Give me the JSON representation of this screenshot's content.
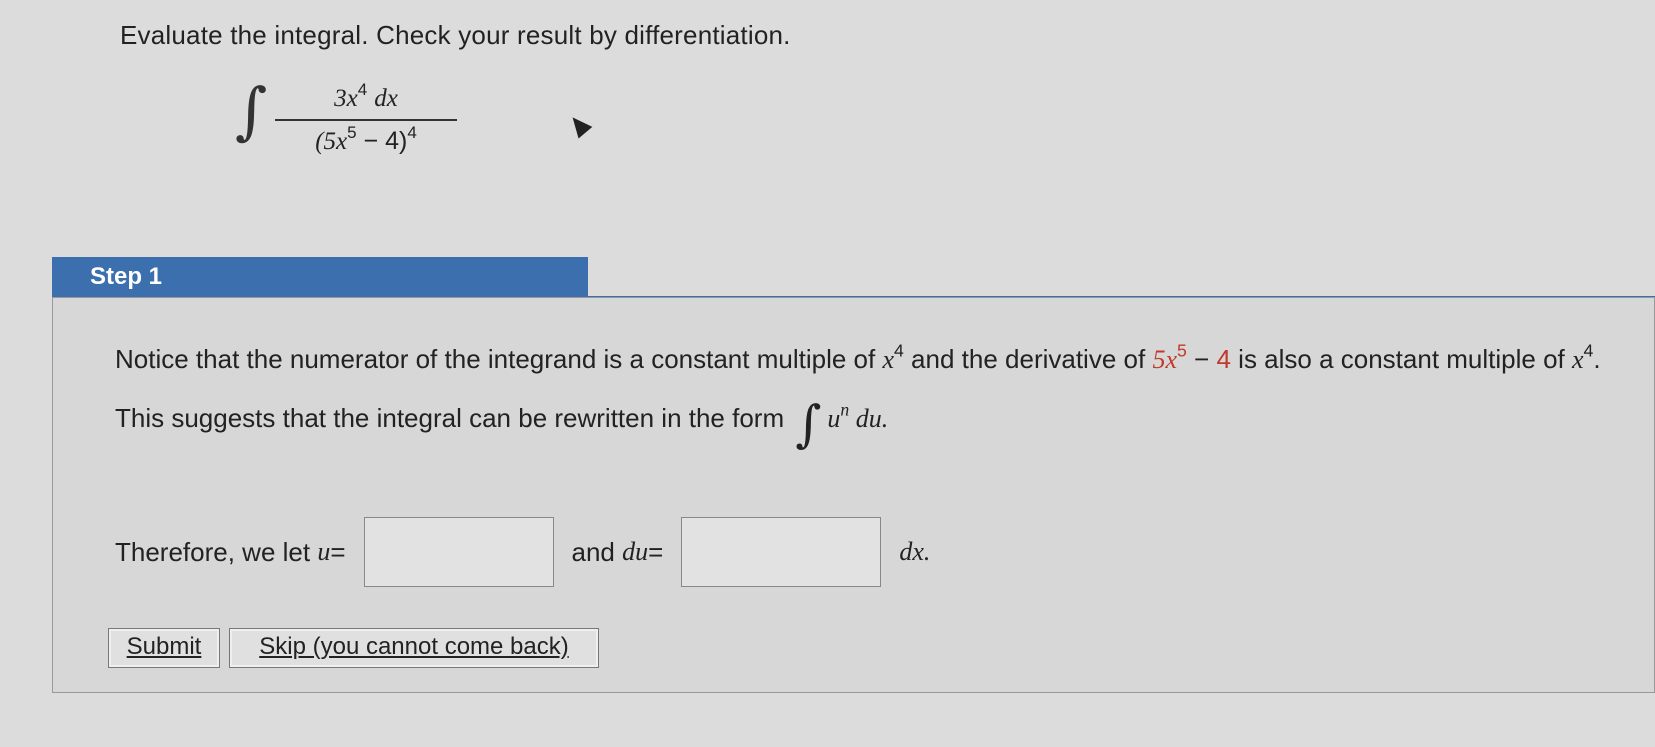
{
  "question": {
    "prompt": "Evaluate the integral. Check your result by differentiation.",
    "integral": {
      "sign": "∫",
      "numerator_coef": "3x",
      "numerator_exp": "4",
      "numerator_dx": "dx",
      "denominator_open": "(5x",
      "denominator_inner_exp": "5",
      "denominator_rest": " − 4)",
      "denominator_exp": "4"
    }
  },
  "step": {
    "title": "Step 1",
    "text_part1": "Notice that the numerator of the integrand is a constant multiple of ",
    "x4_base": "x",
    "x4_exp": "4",
    "text_part2": " and the derivative of ",
    "deriv_base": "5x",
    "deriv_exp": "5",
    "deriv_minus": " − ",
    "deriv_const": "4",
    "text_part3": " is also a constant multiple of ",
    "x4b_base": "x",
    "x4b_exp": "4",
    "text_part4": ". This suggests that the integral can be rewritten in the form ",
    "form_int": "∫",
    "form_base": "u",
    "form_exp": "n",
    "form_du": " du.",
    "answer_prefix": "Therefore, we let ",
    "u_var": "u",
    "equals": " =",
    "and_text": "and ",
    "du_var": "du",
    "equals2": " =",
    "dx_suffix": "dx."
  },
  "buttons": {
    "submit": "Submit",
    "skip": "Skip (you cannot come back)"
  },
  "colors": {
    "step_tab": "#3b6fae",
    "highlight_red": "#c0392b"
  }
}
